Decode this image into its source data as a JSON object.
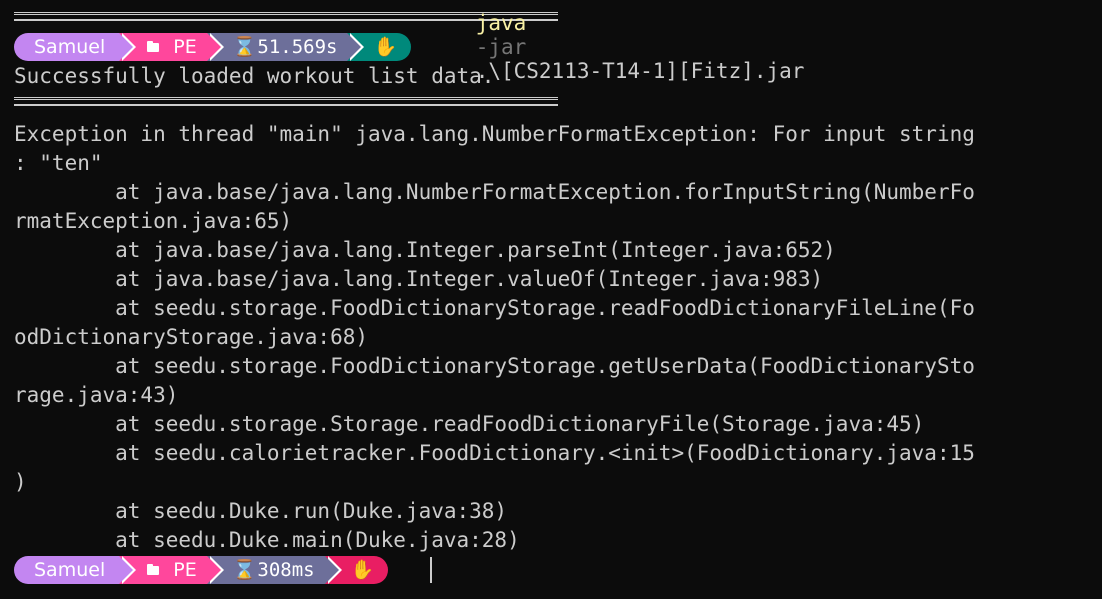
{
  "colors": {
    "background": "#0c0c0c",
    "foreground": "#cccccc",
    "user_segment": "#c386f1",
    "path_segment": "#ff479c",
    "time_segment": "#6d6f9a",
    "status_ok": "#00897b",
    "status_error": "#e91e63",
    "command_keyword": "#f9f1a5",
    "command_flag": "#767676"
  },
  "prompt1": {
    "user": "Samuel",
    "folder_icon": "folder-icon",
    "path": "PE",
    "time_icon": "hourglass-icon",
    "time": "51.569s",
    "status_icon": "hand-icon",
    "command_exe": "java",
    "command_flag": "-jar",
    "command_arg": ".\\[CS2113-T14-1][Fitz].jar"
  },
  "output": {
    "loaded": "Successfully loaded workout list data.",
    "exception_lines": [
      "Exception in thread \"main\" java.lang.NumberFormatException: For input string",
      ": \"ten\"",
      "        at java.base/java.lang.NumberFormatException.forInputString(NumberFo",
      "rmatException.java:65)",
      "        at java.base/java.lang.Integer.parseInt(Integer.java:652)",
      "        at java.base/java.lang.Integer.valueOf(Integer.java:983)",
      "        at seedu.storage.FoodDictionaryStorage.readFoodDictionaryFileLine(Fo",
      "odDictionaryStorage.java:68)",
      "        at seedu.storage.FoodDictionaryStorage.getUserData(FoodDictionarySto",
      "rage.java:43)",
      "        at seedu.storage.Storage.readFoodDictionaryFile(Storage.java:45)",
      "        at seedu.calorietracker.FoodDictionary.<init>(FoodDictionary.java:15",
      ")",
      "        at seedu.Duke.run(Duke.java:38)",
      "        at seedu.Duke.main(Duke.java:28)"
    ]
  },
  "prompt2": {
    "user": "Samuel",
    "folder_icon": "folder-icon",
    "path": "PE",
    "time_icon": "hourglass-icon",
    "time": "308ms",
    "status_icon": "hand-icon"
  }
}
